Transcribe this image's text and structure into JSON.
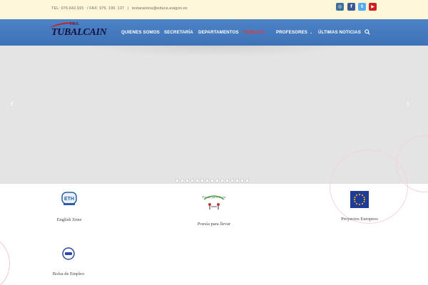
{
  "topbar": {
    "tel": "TEL: 976.642.915",
    "fax": "/ FAX: 976. 199. 137",
    "sep": "|",
    "email": "iestarazona@educa.aragon.es"
  },
  "social": {
    "instagram_icon": "instagram-icon",
    "facebook_icon": "facebook-icon",
    "twitter_icon": "twitter-icon",
    "youtube_icon": "youtube-icon",
    "instagram_glyph": "◎",
    "facebook_glyph": "f",
    "twitter_glyph": "t",
    "youtube_glyph": "▶"
  },
  "logo": {
    "ies": "I.E.S.",
    "name": "TUBALCAIN"
  },
  "nav": {
    "items": [
      {
        "label": "QUIENES SOMOS"
      },
      {
        "label": "SECRETARÍA"
      },
      {
        "label": "DEPARTAMENTOS"
      },
      {
        "label": "FAMILIAS"
      },
      {
        "label": "PROFESORES",
        "chevron": "⌄"
      },
      {
        "label": "ÚLTIMAS NOTICIAS"
      }
    ],
    "active_color": "#e53935"
  },
  "slider": {
    "prev": "‹",
    "next": "›",
    "dot_count": 15
  },
  "items": [
    {
      "label": "English Zone",
      "badge": "ETH"
    },
    {
      "label": "Poesía para llevar",
      "badge": "Poesía para llevar"
    },
    {
      "label": "Proyectos Europeos"
    },
    {
      "label": "Bolsa de Empleo"
    }
  ],
  "colors": {
    "topbar_bg": "#fdf7d8",
    "header_bg": "#4479bd",
    "slider_bg": "#e4e4e4"
  }
}
